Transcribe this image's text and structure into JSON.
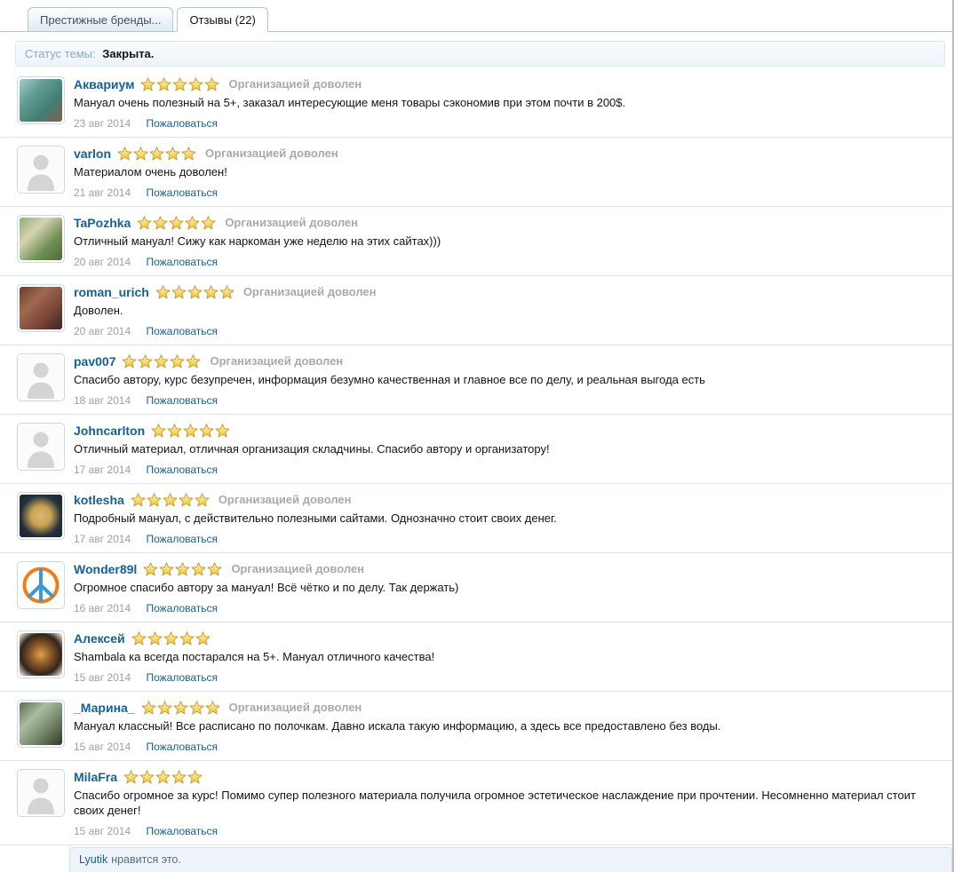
{
  "tabs": [
    {
      "label": "Престижные бренды..."
    },
    {
      "label": "Отзывы (22)"
    }
  ],
  "status": {
    "label": "Статус темы:",
    "value": "Закрыта."
  },
  "colors": {
    "link_blue": "#176093",
    "star_fill_top": "#fdf6c8",
    "star_fill_bottom": "#f2c42d",
    "star_outline": "#c79d32",
    "org_label_gray": "#a9a9a9",
    "date_gray": "#a0a0a0"
  },
  "report_label": "Пожаловаться",
  "org_satisfied_text": "Организацией доволен",
  "reviews": [
    {
      "username": "Аквариум",
      "rating": 5,
      "org_label": "Организацией доволен",
      "text": "Мануал очень полезный на 5+, заказал интересующие меня товары сэкономив при этом почти в 200$.",
      "date": "23 авг 2014",
      "report_label": "Пожаловаться",
      "avatar": {
        "kind": "linear",
        "name": "cheshire-cat-photo",
        "colors": [
          "#a8cdc8",
          "#5f9c92",
          "#417d74",
          "#7d6248"
        ]
      }
    },
    {
      "username": "varlon",
      "rating": 5,
      "org_label": "Организацией доволен",
      "text": "Материалом очень доволен!",
      "date": "21 авг 2014",
      "report_label": "Пожаловаться",
      "avatar": {
        "kind": "default",
        "name": "default-avatar"
      }
    },
    {
      "username": "TaPozhka",
      "rating": 5,
      "org_label": "Организацией доволен",
      "text": "Отличный мануал! Сижу как наркоман уже неделю на этих сайтах)))",
      "date": "20 авг 2014",
      "report_label": "Пожаловаться",
      "avatar": {
        "kind": "linear",
        "name": "garden-photo",
        "colors": [
          "#8fae6f",
          "#d6d2b4",
          "#6f8f54",
          "#4e6b3a"
        ]
      }
    },
    {
      "username": "roman_urich",
      "rating": 5,
      "org_label": "Организацией доволен",
      "text": "Доволен.",
      "date": "20 авг 2014",
      "report_label": "Пожаловаться",
      "avatar": {
        "kind": "linear",
        "name": "painting-photo",
        "colors": [
          "#6b3a30",
          "#a06a50",
          "#7a4438",
          "#3a2520"
        ]
      }
    },
    {
      "username": "pav007",
      "rating": 5,
      "org_label": "Организацией доволен",
      "text": "Спасибо автору, курс безупречен, информация безумно качественная и главное все по делу, и реальная выгода есть",
      "date": "18 авг 2014",
      "report_label": "Пожаловаться",
      "avatar": {
        "kind": "default",
        "name": "default-avatar"
      }
    },
    {
      "username": "Johncarlton",
      "rating": 5,
      "text": "Отличный материал, отличная организация складчины. Спасибо автору и организатору!",
      "date": "17 авг 2014",
      "report_label": "Пожаловаться",
      "avatar": {
        "kind": "default",
        "name": "default-avatar"
      }
    },
    {
      "username": "kotlesha",
      "rating": 5,
      "org_label": "Организацией доволен",
      "text": "Подробный мануал, с действительно полезными сайтами. Однозначно стоит своих денег.",
      "date": "17 авг 2014",
      "report_label": "Пожаловаться",
      "avatar": {
        "kind": "radial",
        "name": "cat-in-suit",
        "colors": [
          "#d9b873",
          "#c8a254",
          "#23303d",
          "#1a242e"
        ]
      }
    },
    {
      "username": "Wonder89l",
      "rating": 5,
      "org_label": "Организацией доволен",
      "text": "Огромное спасибо автору за мануал! Всё чётко и по делу. Так держать)",
      "date": "16 авг 2014",
      "report_label": "Пожаловаться",
      "avatar": {
        "kind": "peace",
        "name": "rainbow-peace-sign"
      }
    },
    {
      "username": "Алексей",
      "rating": 5,
      "text": "Shambala ка всегда постарался на 5+. Мануал отличного качества!",
      "date": "15 авг 2014",
      "report_label": "Пожаловаться",
      "avatar": {
        "kind": "radial",
        "name": "lion-art",
        "colors": [
          "#e0a050",
          "#8a5a28",
          "#33241a",
          "#ffffff"
        ]
      }
    },
    {
      "username": "_Марина_",
      "rating": 5,
      "org_label": "Организацией доволен",
      "text": "Мануал классный! Все расписано по полочкам. Давно искала такую информацию, а здесь все предоставлено без воды.",
      "date": "15 авг 2014",
      "report_label": "Пожаловаться",
      "avatar": {
        "kind": "linear",
        "name": "swing-photo",
        "colors": [
          "#5a6b4d",
          "#a8bfa0",
          "#6e7f62",
          "#2f3a2a"
        ]
      }
    },
    {
      "username": "MilaFra",
      "rating": 5,
      "text": "Спасибо огромное за курс! Помимо супер полезного материала получила огромное эстетическое наслаждение при прочтении. Несомненно материал стоит своих денег!",
      "date": "15 авг 2014",
      "report_label": "Пожаловаться",
      "avatar": {
        "kind": "default",
        "name": "default-avatar"
      }
    }
  ],
  "likes": {
    "user": "Lyutik",
    "suffix": "нравится это."
  }
}
